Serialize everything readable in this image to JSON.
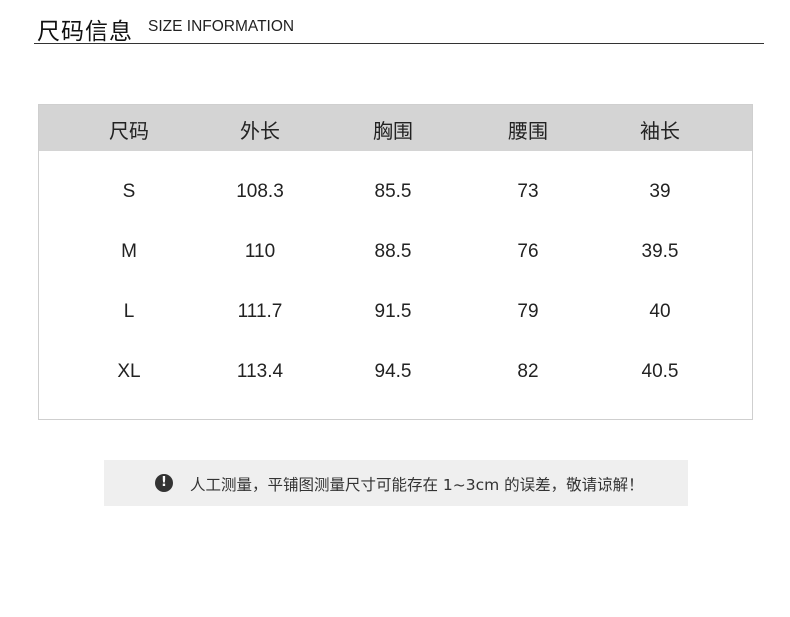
{
  "header": {
    "title": "尺码信息",
    "subtitle": "SIZE INFORMATION"
  },
  "table": {
    "columns": [
      "尺码",
      "外长",
      "胸围",
      "腰围",
      "袖长"
    ],
    "rows": [
      [
        "S",
        "108.3",
        "85.5",
        "73",
        "39"
      ],
      [
        "M",
        "110",
        "88.5",
        "76",
        "39.5"
      ],
      [
        "L",
        "111.7",
        "91.5",
        "79",
        "40"
      ],
      [
        "XL",
        "113.4",
        "94.5",
        "82",
        "40.5"
      ]
    ]
  },
  "note": {
    "icon": "exclamation-circle-icon",
    "icon_glyph": "!",
    "text": "人工测量，平铺图测量尺寸可能存在 1~3cm 的误差，敬请谅解！"
  }
}
